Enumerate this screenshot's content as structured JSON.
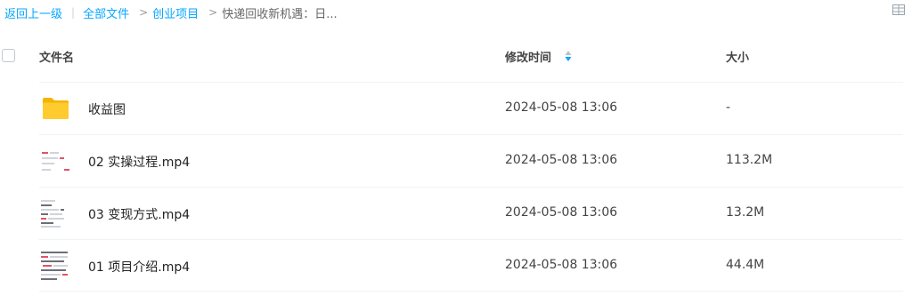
{
  "breadcrumb": {
    "back_label": "返回上一级",
    "all_files_label": "全部文件",
    "project_label": "创业项目",
    "current_label": "快递回收新机遇：日..."
  },
  "table": {
    "col_name": "文件名",
    "col_time": "修改时间",
    "col_size": "大小"
  },
  "files": [
    {
      "name": "收益图",
      "time": "2024-05-08 13:06",
      "size": "-",
      "type": "folder"
    },
    {
      "name": "02 实操过程.mp4",
      "time": "2024-05-08 13:06",
      "size": "113.2M",
      "type": "video"
    },
    {
      "name": "03 变现方式.mp4",
      "time": "2024-05-08 13:06",
      "size": "13.2M",
      "type": "video"
    },
    {
      "name": "01 项目介绍.mp4",
      "time": "2024-05-08 13:06",
      "size": "44.4M",
      "type": "video"
    }
  ],
  "colors": {
    "link": "#06a7ff",
    "folder": "#ffc830",
    "sort_active": "#06a7ff"
  },
  "icons": {
    "grid_view": "grid-view-icon",
    "sort": "sort-icon",
    "folder": "folder-icon"
  }
}
